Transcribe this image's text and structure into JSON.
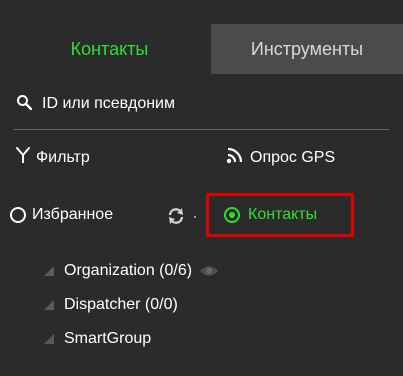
{
  "tabs": {
    "active": "Контакты",
    "inactive": "Инструменты"
  },
  "search": {
    "placeholder": "ID или псевдоним"
  },
  "filters": {
    "filter_label": "Фильтр",
    "gps_label": "Опрос GPS"
  },
  "view": {
    "favorites_label": "Избранное",
    "contacts_label": "Контакты",
    "selected": "contacts"
  },
  "tree": [
    {
      "label": "Organization (0/6)",
      "has_eye": true
    },
    {
      "label": "Dispatcher (0/0)",
      "has_eye": false
    },
    {
      "label": "SmartGroup",
      "has_eye": false
    }
  ],
  "colors": {
    "accent": "#2ee02e",
    "highlight": "#e00000",
    "background": "#2b2b2b",
    "inactive_tab": "#4b4b4b"
  }
}
